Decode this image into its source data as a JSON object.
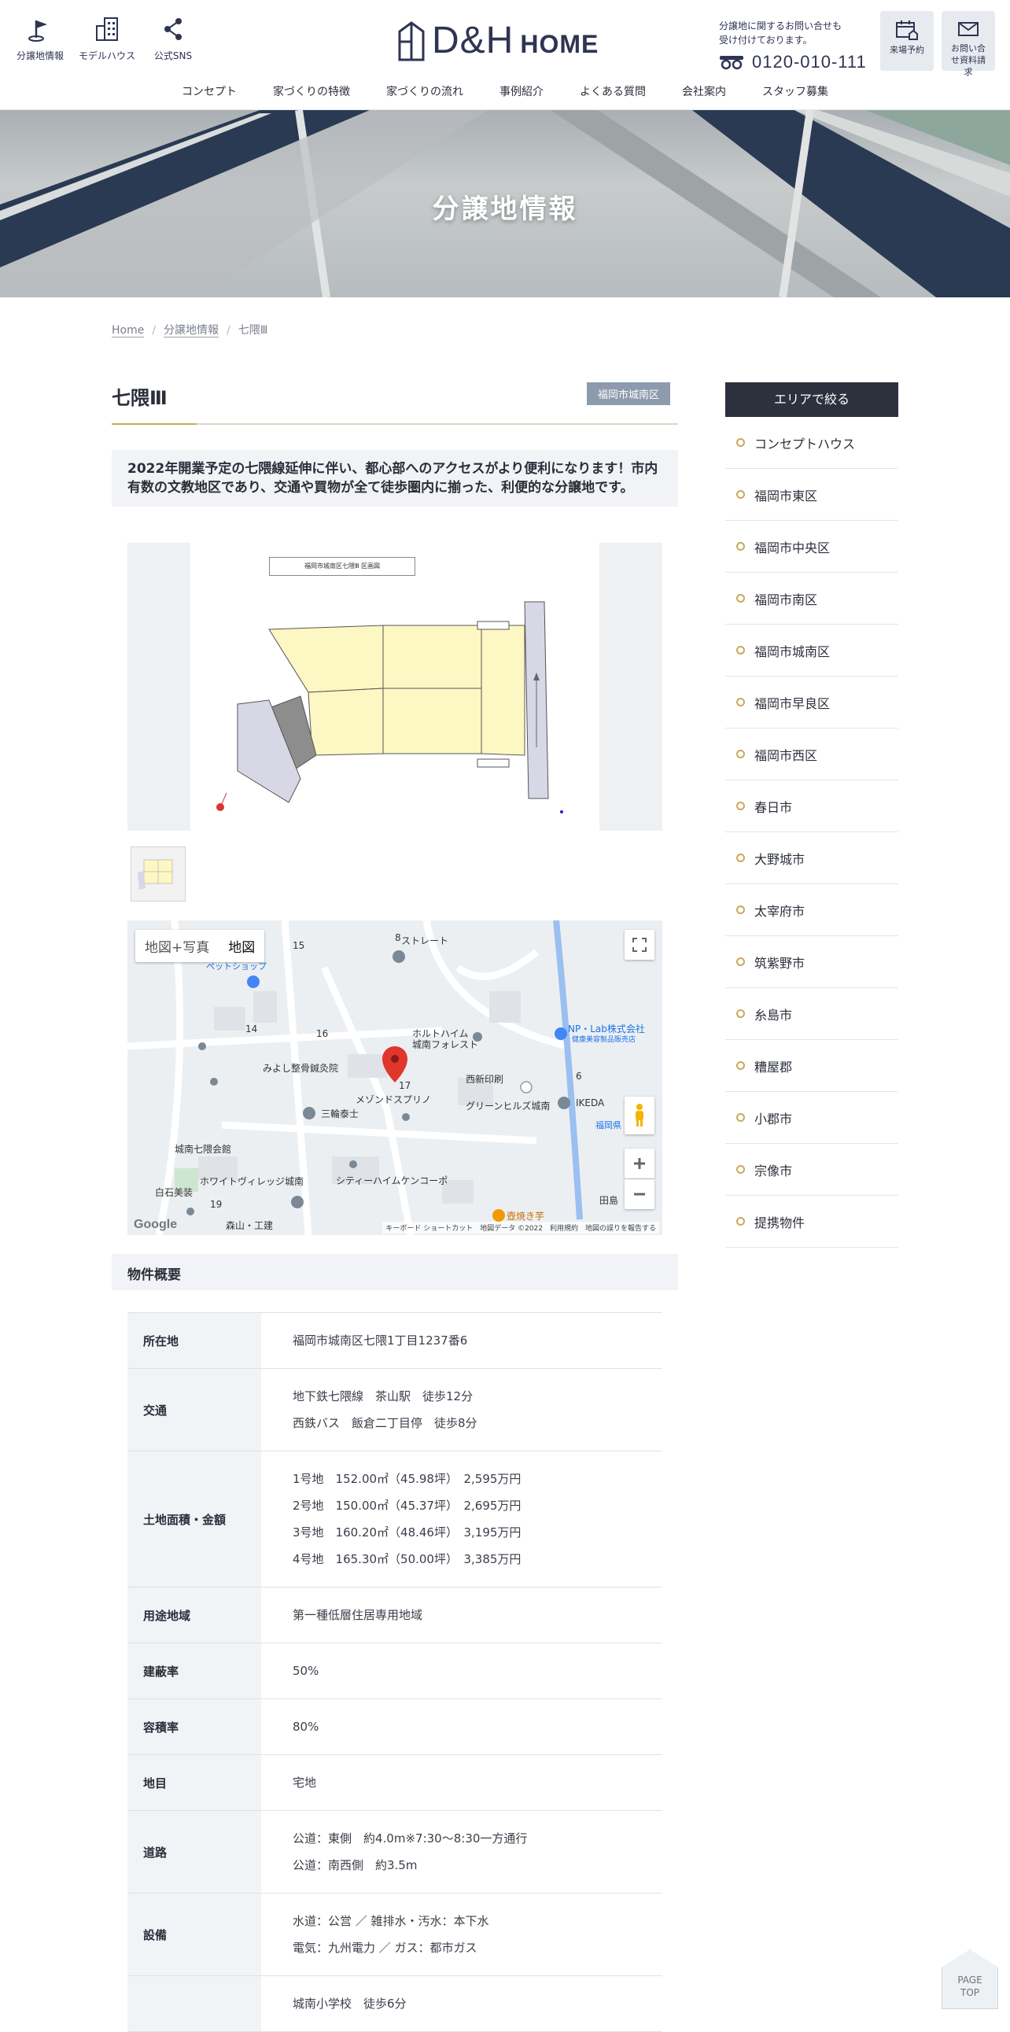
{
  "header": {
    "icons": [
      {
        "label": "分譲地情報",
        "icon": "flag-icon"
      },
      {
        "label": "モデルハウス",
        "icon": "building-icon"
      },
      {
        "label": "公式SNS",
        "icon": "share-icon"
      }
    ],
    "logo_main": "D&H",
    "logo_sub": "HOME",
    "contact_note": "分譲地に関するお問い合せも受け付けております。",
    "tel": "0120-010-111",
    "buttons": [
      {
        "label": "来場予約",
        "icon": "calendar-house-icon"
      },
      {
        "label": "お問い合せ資料請求",
        "icon": "mail-icon"
      }
    ]
  },
  "nav": [
    "コンセプト",
    "家づくりの特徴",
    "家づくりの流れ",
    "事例紹介",
    "よくある質問",
    "会社案内",
    "スタッフ募集"
  ],
  "hero": {
    "title": "分譲地情報"
  },
  "breadcrumb": {
    "home": "Home",
    "parent": "分譲地情報",
    "current": "七隈Ⅲ"
  },
  "property": {
    "title": "七隈Ⅲ",
    "area_tag": "福岡市城南区",
    "lead": "2022年開業予定の七隈線延伸に伴い、都心部へのアクセスがより便利になります！市内有数の文教地区であり、交通や買物が全て徒歩圏内に揃った、利便的な分譲地です。",
    "plan_caption": "福岡市城南区七隈Ⅲ 区画図"
  },
  "map": {
    "type_options": [
      "地図+写真",
      "地図"
    ],
    "selected_type": "地図",
    "labels": [
      "ホルトハイム城南フォレスト",
      "みよし整骨鍼灸院",
      "西新印刷",
      "メゾンドスプリノ",
      "三輪泰士",
      "グリーンヒルズ城南",
      "IKEDA",
      "NP・Lab株式会社",
      "健康美容製品販売店",
      "ペットショップ",
      "城南七隈会館",
      "白石美装",
      "ホワイトヴィレッジ城南",
      "シティーハイムケンコーポ",
      "壺焼き芋",
      "森山・工建",
      "田島",
      "ストレート",
      "福岡県"
    ],
    "numbers": [
      "15",
      "14",
      "16",
      "17",
      "6",
      "19",
      "8"
    ],
    "brand": "Google",
    "footer": "キーボード ショートカット　地図データ ©2022　利用規約　地図の誤りを報告する"
  },
  "spec": {
    "heading": "物件概要",
    "rows": [
      {
        "label": "所在地",
        "lines": [
          "福岡市城南区七隈1丁目1237番6"
        ]
      },
      {
        "label": "交通",
        "lines": [
          "地下鉄七隈線　茶山駅　徒歩12分",
          "西鉄バス　飯倉二丁目停　徒歩8分"
        ]
      },
      {
        "label": "土地面積・金額",
        "lines": [
          "1号地　152.00㎡（45.98坪）　2,595万円",
          "2号地　150.00㎡（45.37坪）　2,695万円",
          "3号地　160.20㎡（48.46坪）　3,195万円",
          "4号地　165.30㎡（50.00坪）　3,385万円"
        ]
      },
      {
        "label": "用途地域",
        "lines": [
          "第一種低層住居専用地域"
        ]
      },
      {
        "label": "建蔽率",
        "lines": [
          "50%"
        ]
      },
      {
        "label": "容積率",
        "lines": [
          "80%"
        ]
      },
      {
        "label": "地目",
        "lines": [
          "宅地"
        ]
      },
      {
        "label": "道路",
        "lines": [
          "公道：東側　約4.0m※7:30～8:30一方通行",
          "公道：南西側　約3.5m"
        ]
      },
      {
        "label": "設備",
        "lines": [
          "水道：公営 ／ 雑排水・汚水：本下水",
          "電気：九州電力 ／ ガス：都市ガス"
        ]
      },
      {
        "label": "",
        "lines": [
          "城南小学校　徒歩6分"
        ]
      }
    ]
  },
  "sidebar": {
    "heading": "エリアで絞る",
    "items": [
      "コンセプトハウス",
      "福岡市東区",
      "福岡市中央区",
      "福岡市南区",
      "福岡市城南区",
      "福岡市早良区",
      "福岡市西区",
      "春日市",
      "大野城市",
      "太宰府市",
      "筑紫野市",
      "糸島市",
      "糟屋郡",
      "小郡市",
      "宗像市",
      "提携物件"
    ]
  },
  "page_top": "PAGE TOP",
  "colors": {
    "accent": "#c9a860",
    "navy": "#2f3452",
    "sidebar_head": "#2c313d",
    "tag": "#8e9aad"
  }
}
